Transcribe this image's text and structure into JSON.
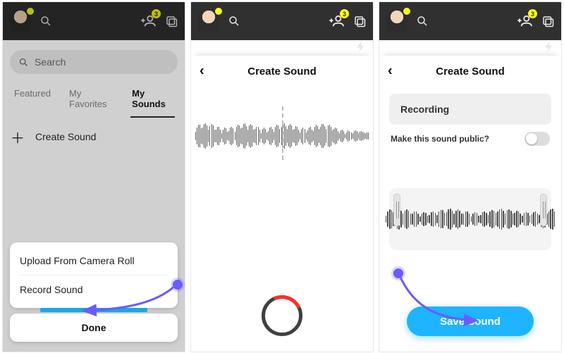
{
  "topbar": {
    "notification_count": "3"
  },
  "panel1": {
    "search_placeholder": "Search",
    "tabs": {
      "featured": "Featured",
      "favorites": "My Favorites",
      "mysounds": "My Sounds"
    },
    "create_sound": "Create Sound",
    "sheet": {
      "upload": "Upload From Camera Roll",
      "record": "Record Sound",
      "done": "Done"
    }
  },
  "panel2": {
    "title": "Create Sound"
  },
  "panel3": {
    "title": "Create Sound",
    "recording_label": "Recording",
    "public_label": "Make this sound public?",
    "save": "Save Sound"
  }
}
